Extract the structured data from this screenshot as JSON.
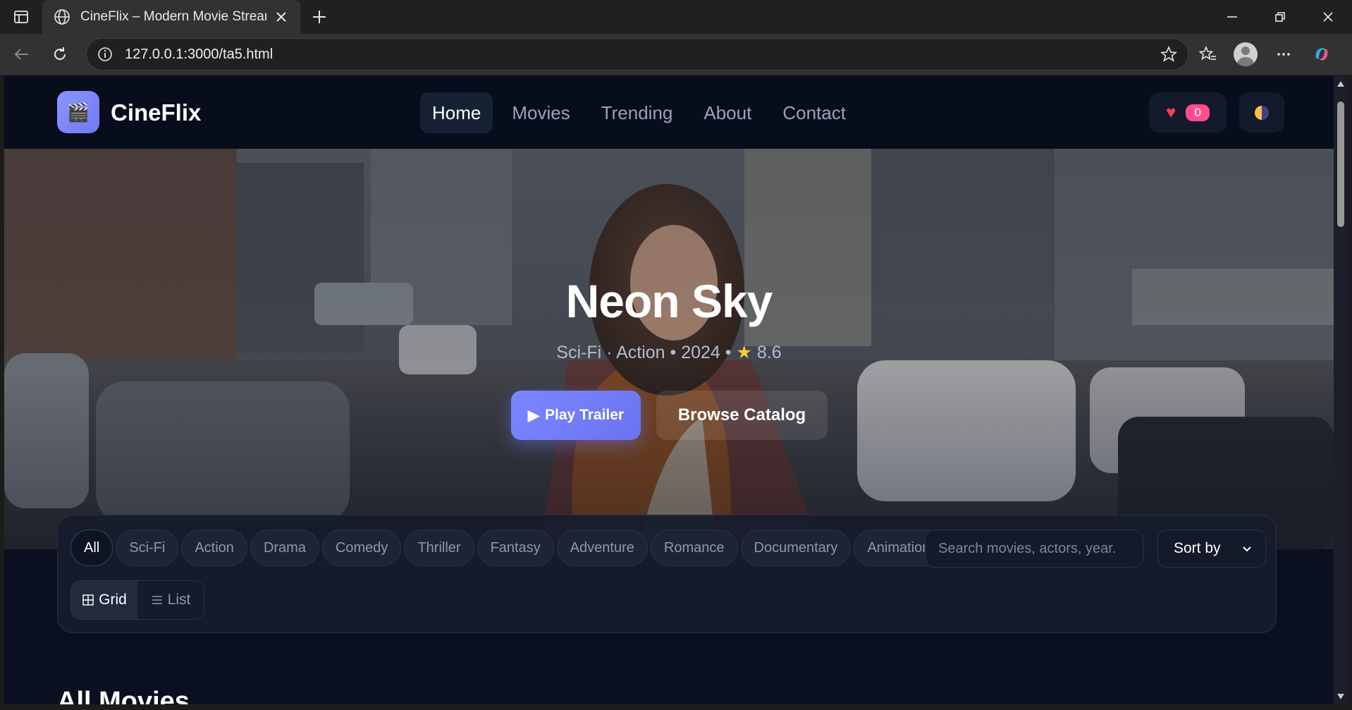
{
  "browser": {
    "tab_title": "CineFlix – Modern Movie Streaming",
    "url": "127.0.0.1:3000/ta5.html"
  },
  "header": {
    "brand": "CineFlix",
    "nav": [
      {
        "label": "Home",
        "active": true
      },
      {
        "label": "Movies",
        "active": false
      },
      {
        "label": "Trending",
        "active": false
      },
      {
        "label": "About",
        "active": false
      },
      {
        "label": "Contact",
        "active": false
      }
    ],
    "favorites_count": "0"
  },
  "hero": {
    "title": "Neon Sky",
    "meta": "Sci-Fi · Action • 2024 •",
    "rating": "8.6",
    "play_label": "Play Trailer",
    "browse_label": "Browse Catalog"
  },
  "filters": {
    "genres": [
      {
        "label": "All",
        "active": true
      },
      {
        "label": "Sci-Fi",
        "active": false
      },
      {
        "label": "Action",
        "active": false
      },
      {
        "label": "Drama",
        "active": false
      },
      {
        "label": "Comedy",
        "active": false
      },
      {
        "label": "Thriller",
        "active": false
      },
      {
        "label": "Fantasy",
        "active": false
      },
      {
        "label": "Adventure",
        "active": false
      },
      {
        "label": "Romance",
        "active": false
      },
      {
        "label": "Documentary",
        "active": false
      },
      {
        "label": "Animation",
        "active": false
      }
    ],
    "search_placeholder": "Search movies, actors, year.",
    "sort_label": "Sort by",
    "view_grid": "Grid",
    "view_list": "List"
  },
  "section": {
    "title": "All Movies"
  },
  "colors": {
    "accent": "#7c86ff",
    "page_bg": "#0b1020",
    "badge": "#ff4d8d"
  }
}
